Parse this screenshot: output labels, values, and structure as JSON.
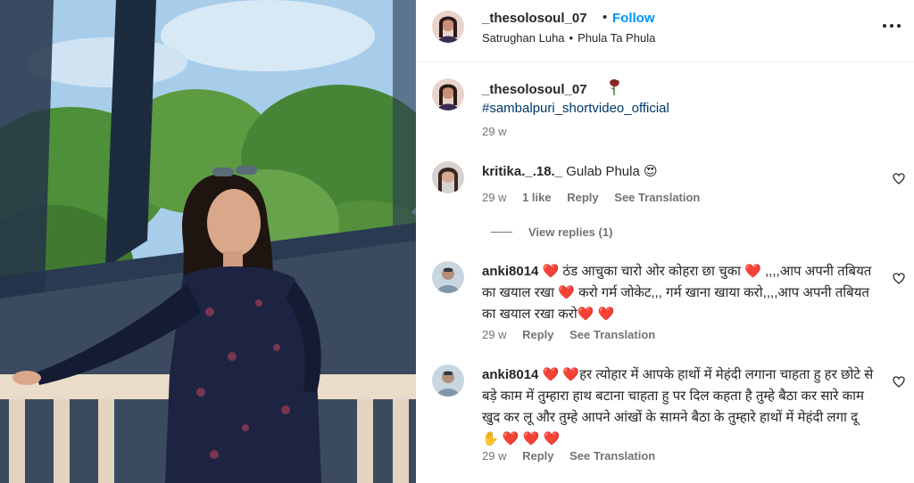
{
  "post": {
    "username": "_thesolosoul_07",
    "dot": "•",
    "follow_label": "Follow",
    "audio_artist": "Satrughan Luha",
    "audio_sep": "•",
    "audio_title": "Phula Ta Phula"
  },
  "caption": {
    "username": "_thesolosoul_07",
    "hashtag": "#sambalpuri_shortvideo_official",
    "time": "29 w"
  },
  "comments": [
    {
      "username": "kritika._.18._",
      "text": "Gulab Phula 😍",
      "time": "29 w",
      "likes": "1 like",
      "reply_label": "Reply",
      "translate_label": "See Translation",
      "view_replies_label": "View replies (1)"
    },
    {
      "username": "anki8014",
      "text": "❤️ ठंड आचुका चारो ओर कोहरा छा चुका ❤️ ,,,,आप अपनी तबियत का खयाल रखा ❤️ करो गर्म जोकेट,,, गर्म खाना खाया करो,,,,आप अपनी तबियत का खयाल रखा करो❤️ ❤️",
      "time": "29 w",
      "reply_label": "Reply",
      "translate_label": "See Translation"
    },
    {
      "username": "anki8014",
      "text": "❤️ ❤️हर त्योहार में आपके हाथों में मेहंदी लगाना चाहता हु हर छोटे से बड़े काम में तुम्हारा हाथ बटाना चाहता हु पर दिल कहता है तुम्हे बैठा कर सारे काम खुद कर लू और तुम्हे आपने आंखों के सामने बैठा के तुम्हारे हाथों में मेहंदी लगा दू ✋ ❤️ ❤️ ❤️",
      "time": "29 w",
      "reply_label": "Reply",
      "translate_label": "See Translation"
    }
  ],
  "icons": {
    "more": "more-options-icon",
    "like": "heart-outline-icon",
    "rose": "wilted-rose-icon"
  },
  "colors": {
    "follow": "#0095f6",
    "hashtag": "#00376b",
    "meta": "#737373",
    "text": "#262626"
  }
}
